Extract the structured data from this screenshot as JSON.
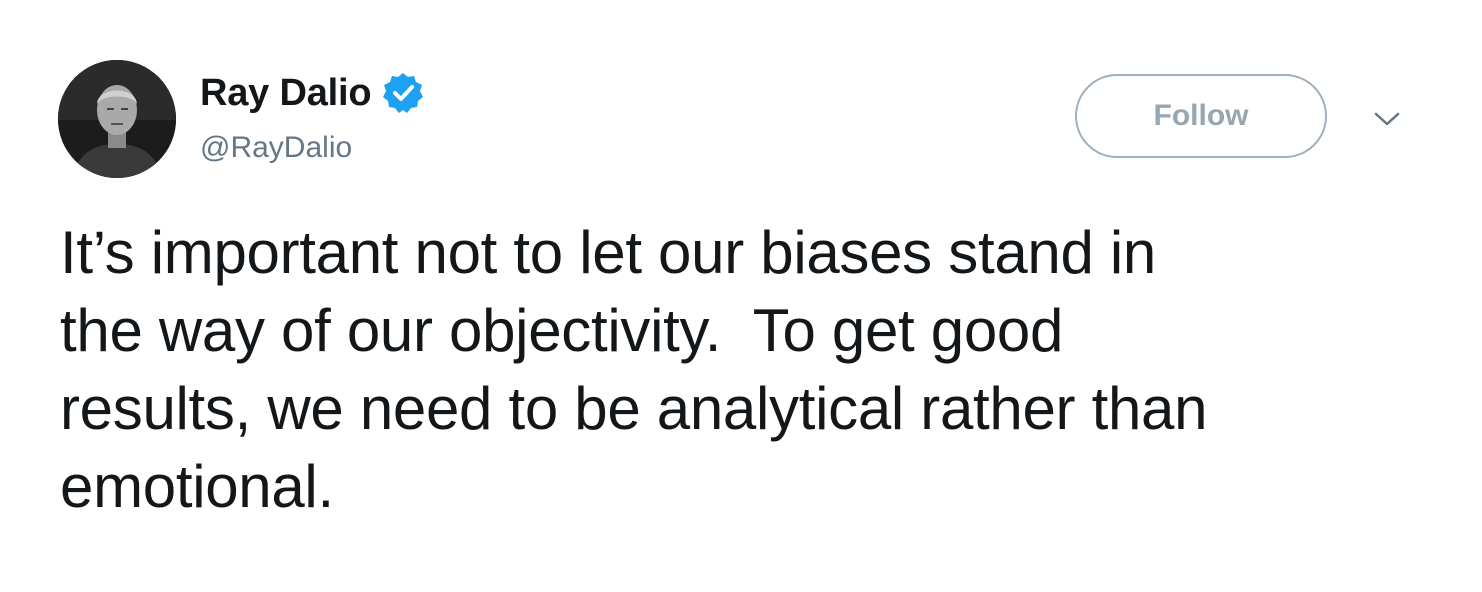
{
  "tweet": {
    "author": {
      "display_name": "Ray Dalio",
      "handle": "@RayDalio",
      "verified": true,
      "avatar_icon": "profile-photo"
    },
    "follow_label": "Follow",
    "menu_icon": "chevron-down-icon",
    "text": "It’s important not to let our biases stand in\nthe way of our objectivity.  To get good\nresults, we need to be analytical rather than\nemotional."
  },
  "colors": {
    "text": "#14171a",
    "secondary": "#657786",
    "verified_blue": "#1da1f2",
    "follow_border": "#9fb1c0",
    "follow_text": "#97a6b3",
    "background": "#ffffff"
  }
}
